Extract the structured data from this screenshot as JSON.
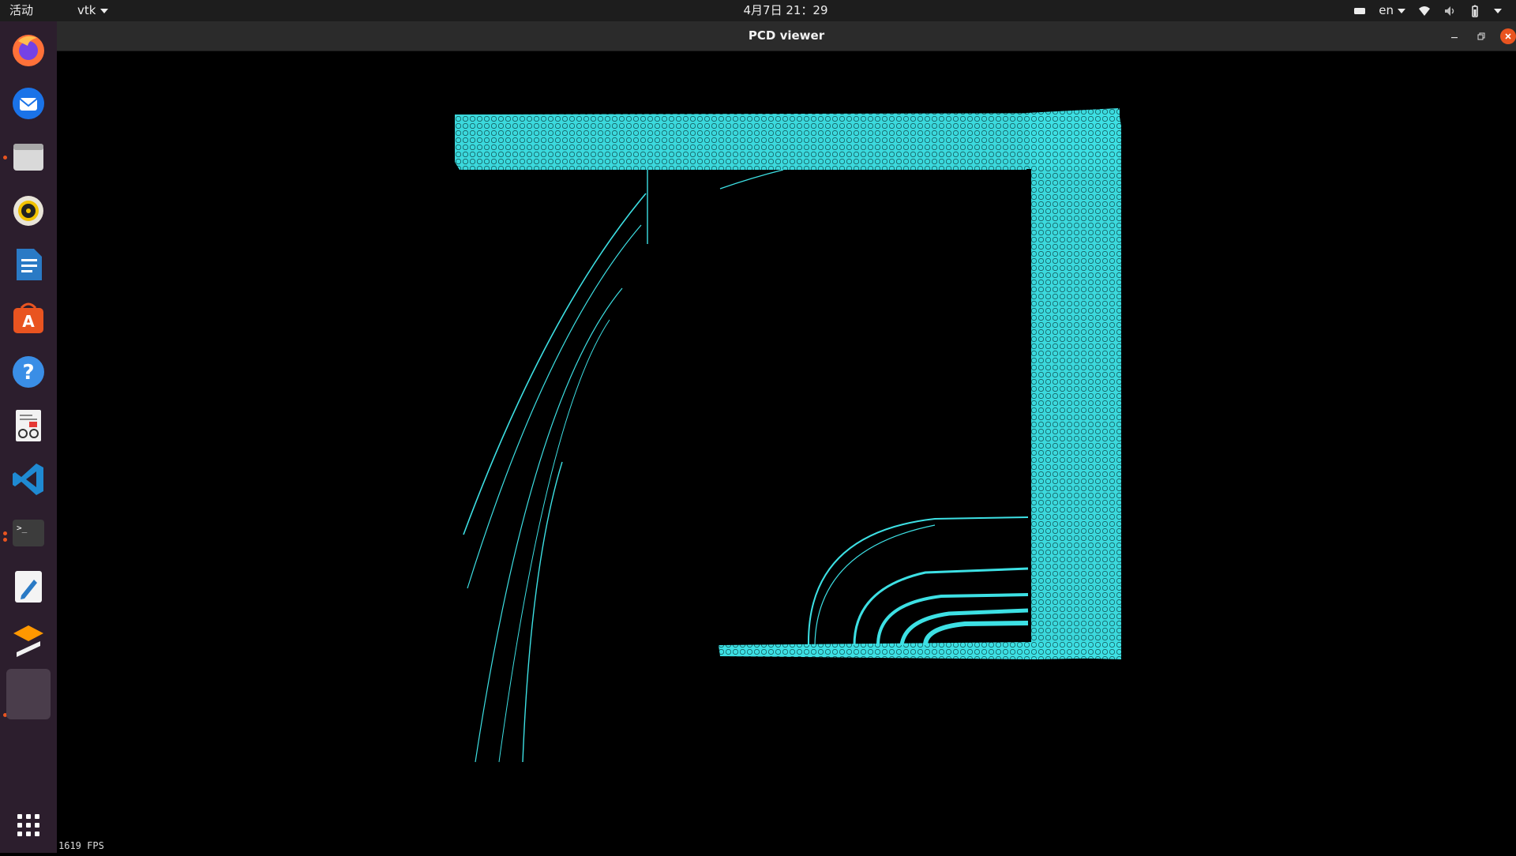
{
  "topbar": {
    "activities_label": "活动",
    "app_menu_label": "vtk",
    "clock": "4月7日  21：29",
    "language": "en",
    "tray_icons": [
      "keyboard-icon",
      "network-wifi-icon",
      "volume-icon",
      "battery-icon",
      "system-menu-icon"
    ]
  },
  "dock": {
    "items": [
      {
        "name": "firefox-icon",
        "running": false
      },
      {
        "name": "thunderbird-icon",
        "running": false
      },
      {
        "name": "files-icon",
        "running": true
      },
      {
        "name": "rhythmbox-icon",
        "running": false
      },
      {
        "name": "libreoffice-writer-icon",
        "running": false
      },
      {
        "name": "software-center-icon",
        "running": false
      },
      {
        "name": "help-icon",
        "running": false
      },
      {
        "name": "document-viewer-icon",
        "running": false
      },
      {
        "name": "vscode-icon",
        "running": false
      },
      {
        "name": "terminal-icon",
        "running": true
      },
      {
        "name": "text-editor-icon",
        "running": false
      },
      {
        "name": "sublime-text-icon",
        "running": false
      },
      {
        "name": "pcd-viewer-app-icon",
        "running": true,
        "active": true
      }
    ],
    "show_apps_label": "show-applications-icon"
  },
  "window": {
    "title": "PCD viewer",
    "fps_label": "1619 FPS"
  },
  "colors": {
    "point_cloud": "#3de0e4",
    "topbar": "#1d1d1d",
    "dock": "#2c1e2d",
    "accent": "#e95420"
  }
}
